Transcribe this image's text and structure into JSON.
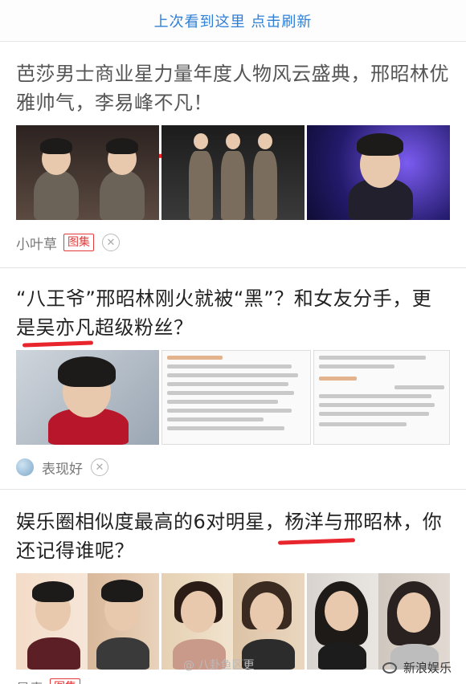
{
  "refresh": {
    "label": "上次看到这里 点击刷新"
  },
  "articles": [
    {
      "title": "芭莎男士商业星力量年度人物风云盛典，邢昭林优雅帅气，李易峰不凡！",
      "source": "小叶草",
      "tag": "图集",
      "close": "✕"
    },
    {
      "title": "“八王爷”邢昭林刚火就被“黑”？和女友分手，更是吴亦凡超级粉丝？",
      "source": "表现好",
      "close": "✕"
    },
    {
      "title": "娱乐圈相似度最高的6对明星，杨洋与邢昭林，你还记得谁呢？",
      "source": "曼青",
      "tag": "图集"
    }
  ],
  "watermarks": {
    "left": "@ 八卦鱼区更",
    "brand": "新浪娱乐"
  },
  "colors": {
    "accent": "#2f7fd6",
    "tag": "#e23a3a",
    "underline": "#e8242c"
  }
}
